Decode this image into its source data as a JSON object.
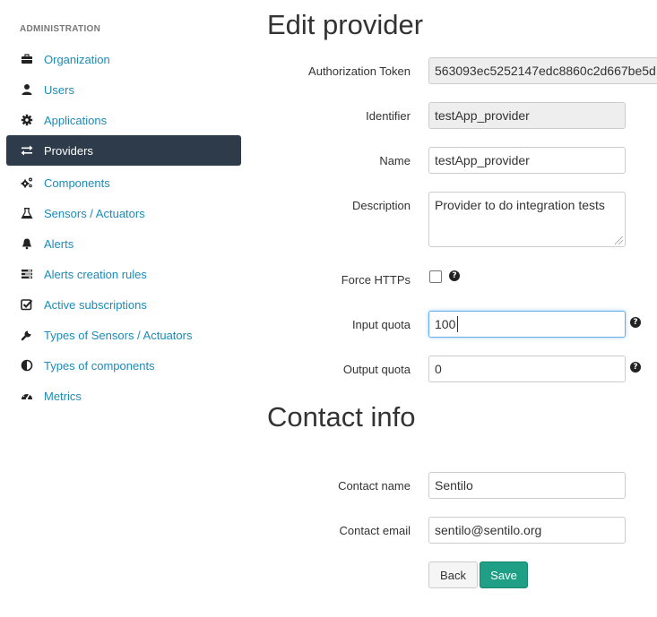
{
  "sidebar": {
    "header": "ADMINISTRATION",
    "items": [
      {
        "label": "Organization",
        "icon": "briefcase-icon",
        "active": false
      },
      {
        "label": "Users",
        "icon": "user-icon",
        "active": false
      },
      {
        "label": "Applications",
        "icon": "gear-icon",
        "active": false
      },
      {
        "label": "Providers",
        "icon": "exchange-icon",
        "active": true
      },
      {
        "label": "Components",
        "icon": "cogs-icon",
        "active": false
      },
      {
        "label": "Sensors / Actuators",
        "icon": "flask-icon",
        "active": false
      },
      {
        "label": "Alerts",
        "icon": "bell-icon",
        "active": false
      },
      {
        "label": "Alerts creation rules",
        "icon": "tasks-icon",
        "active": false
      },
      {
        "label": "Active subscriptions",
        "icon": "check-square-icon",
        "active": false
      },
      {
        "label": "Types of Sensors / Actuators",
        "icon": "wrench-icon",
        "active": false
      },
      {
        "label": "Types of components",
        "icon": "adjust-icon",
        "active": false
      },
      {
        "label": "Metrics",
        "icon": "dashboard-icon",
        "active": false
      }
    ]
  },
  "form": {
    "title": "Edit provider",
    "auth_token": {
      "label": "Authorization Token",
      "value": "563093ec5252147edc8860c2d667be5d"
    },
    "identifier": {
      "label": "Identifier",
      "value": "testApp_provider"
    },
    "name": {
      "label": "Name",
      "value": "testApp_provider"
    },
    "description": {
      "label": "Description",
      "value": "Provider to do integration tests"
    },
    "force_https": {
      "label": "Force HTTPs",
      "checked": false
    },
    "input_quota": {
      "label": "Input quota",
      "value": "100"
    },
    "output_quota": {
      "label": "Output quota",
      "value": "0"
    }
  },
  "contact": {
    "title": "Contact info",
    "name": {
      "label": "Contact name",
      "value": "Sentilo"
    },
    "email": {
      "label": "Contact email",
      "value": "sentilo@sentilo.org"
    }
  },
  "buttons": {
    "back": "Back",
    "save": "Save"
  },
  "help_icon_glyph": "?",
  "colors": {
    "link": "#1b8bb8",
    "active_nav_bg": "#2e3b4a",
    "save_button": "#1fa086"
  }
}
